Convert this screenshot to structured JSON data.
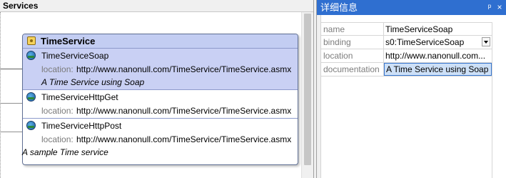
{
  "services_pane": {
    "title": "Services",
    "service": {
      "name": "TimeService",
      "documentation": "A sample Time service",
      "location_label": "location:",
      "ports": [
        {
          "name": "TimeServiceSoap",
          "location": "http://www.nanonull.com/TimeService/TimeService.asmx",
          "documentation": "A Time Service using Soap"
        },
        {
          "name": "TimeServiceHttpGet",
          "location": "http://www.nanonull.com/TimeService/TimeService.asmx"
        },
        {
          "name": "TimeServiceHttpPost",
          "location": "http://www.nanonull.com/TimeService/TimeService.asmx"
        }
      ]
    }
  },
  "details_pane": {
    "title": "详细信息",
    "pin_glyph": "ᵖ",
    "close_glyph": "×",
    "properties": [
      {
        "key": "name",
        "value": "TimeServiceSoap"
      },
      {
        "key": "binding",
        "value": "s0:TimeServiceSoap"
      },
      {
        "key": "location",
        "value": "http://www.nanonull.com..."
      },
      {
        "key": "documentation",
        "value": "A Time Service using Soap"
      }
    ]
  },
  "colors": {
    "details_header": "#2f6fd0",
    "service_title": "#c3cdf2",
    "selected_port": "#c9d0f4",
    "selected_value": "#cde0f7"
  }
}
